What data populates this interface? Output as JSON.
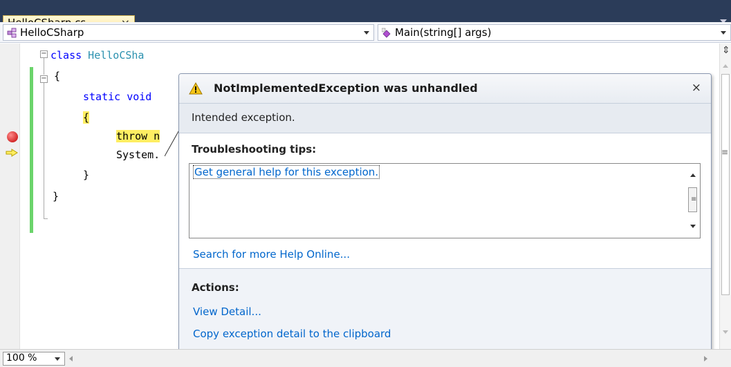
{
  "tabs": [
    {
      "label": "HelloCSharp.cs",
      "close": "×"
    }
  ],
  "navbar": {
    "class_combo": "HelloCSharp",
    "member_combo": "Main(string[] args)"
  },
  "code": {
    "line1_kw": "class",
    "line1_name": " HelloCSha",
    "line2": "{",
    "line3_kw": "static",
    "line3_rest": " void",
    "line4": "{",
    "line5_hl": "throw n",
    "line6": "System.",
    "line7": "}",
    "line8": "}"
  },
  "exception": {
    "title": "NotImplementedException was unhandled",
    "close": "×",
    "message": "Intended exception.",
    "tips_label": "Troubleshooting tips:",
    "tips": [
      "Get general help for this exception."
    ],
    "search_link": "Search for more Help Online...",
    "actions_label": "Actions:",
    "actions": [
      "View Detail...",
      "Copy exception detail to the clipboard"
    ]
  },
  "status": {
    "zoom": "100 %"
  },
  "colors": {
    "keyword": "#0000ff",
    "type": "#2b91af",
    "link": "#0066cc",
    "highlight": "#ffee62"
  }
}
